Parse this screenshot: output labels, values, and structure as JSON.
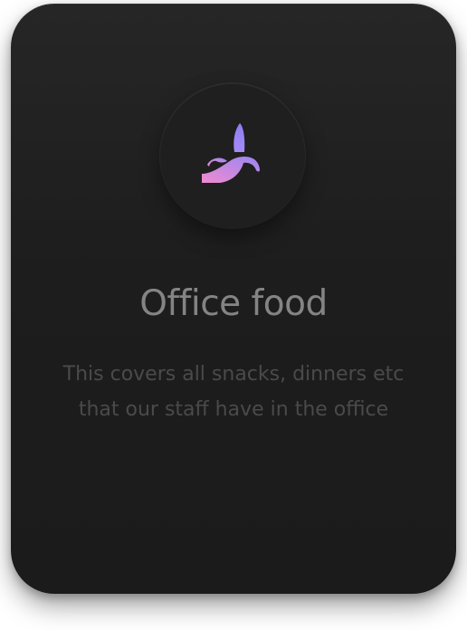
{
  "card": {
    "icon": "banana-icon",
    "title": "Office food",
    "description": "This covers all snacks, dinners etc that our staff have in the office"
  },
  "colors": {
    "card_background": "#1d1d1d",
    "title": "#848484",
    "description": "#4a4a4a",
    "icon_gradient_start": "#ef8ccf",
    "icon_gradient_end": "#9b85f2"
  }
}
